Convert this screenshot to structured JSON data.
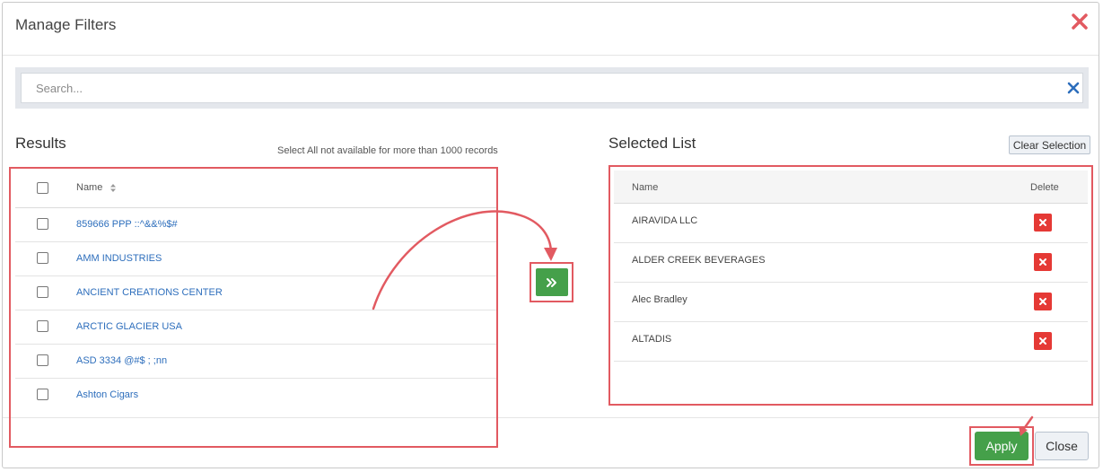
{
  "modal": {
    "title": "Manage Filters"
  },
  "search": {
    "placeholder": "Search..."
  },
  "results": {
    "title": "Results",
    "note": "Select All not available for more than 1000 records",
    "column_name": "Name",
    "rows": [
      "859666 PPP ::^&&%$#",
      "AMM INDUSTRIES",
      "ANCIENT CREATIONS CENTER",
      "ARCTIC GLACIER USA",
      "ASD 3334 @#$ ; ;nn",
      "Ashton Cigars"
    ]
  },
  "selected": {
    "title": "Selected List",
    "clear_label": "Clear Selection",
    "column_name": "Name",
    "column_delete": "Delete",
    "rows": [
      "AIRAVIDA LLC",
      "ALDER CREEK BEVERAGES",
      "Alec Bradley",
      "ALTADIS"
    ]
  },
  "footer": {
    "apply_label": "Apply",
    "close_label": "Close"
  },
  "colors": {
    "accent_green": "#45a04a",
    "delete_red": "#e53935",
    "link_blue": "#2d6ebc",
    "annotation_red": "#e25a61"
  },
  "icons": {
    "close": "close-icon",
    "search_clear": "clear-search-icon",
    "sort": "sort-icon",
    "transfer": "double-chevron-right-icon",
    "delete": "delete-icon"
  }
}
